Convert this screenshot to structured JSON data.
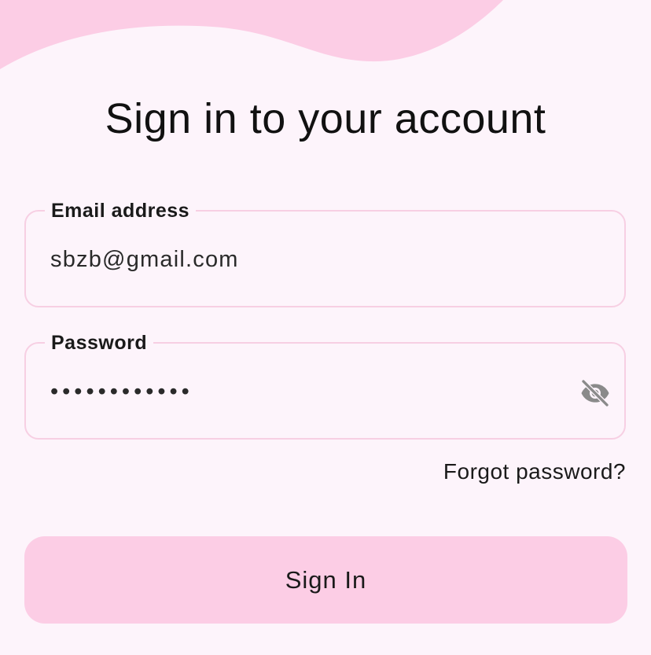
{
  "page": {
    "title": "Sign in to your account"
  },
  "form": {
    "email": {
      "label": "Email address",
      "value": "sbzb@gmail.com"
    },
    "password": {
      "label": "Password",
      "value_masked": "••••••••••••",
      "toggle_icon": "eye-off-icon"
    },
    "forgot_password": "Forgot password?",
    "submit_label": "Sign In"
  },
  "colors": {
    "background": "#fdf4fb",
    "accent_pink": "#fccde5",
    "field_border": "#f7cfe3",
    "icon_gray": "#8a8a8a"
  }
}
